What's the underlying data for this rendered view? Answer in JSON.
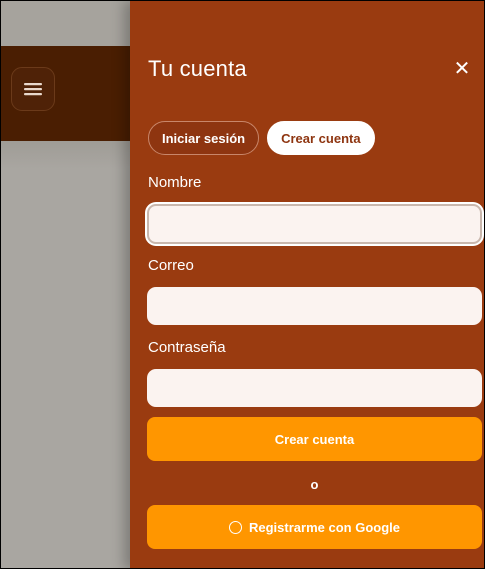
{
  "drawer": {
    "title": "Tu cuenta",
    "close_glyph": "✕",
    "tabs": [
      {
        "label": "Iniciar sesión",
        "active": false
      },
      {
        "label": "Crear cuenta",
        "active": true
      }
    ]
  },
  "form": {
    "name_label": "Nombre",
    "name_value": "",
    "email_label": "Correo",
    "email_value": "",
    "password_label": "Contraseña",
    "password_value": "",
    "submit_label": "Crear cuenta",
    "separator": "o",
    "google_label": "Registrarme con Google",
    "google_icon": "google-circle-icon"
  },
  "background": {
    "menu_icon": "hamburger-menu-icon"
  },
  "colors": {
    "drawer_bg": "#9a3b10",
    "accent": "#ff9600",
    "header_bg": "#4a1e02",
    "input_bg": "#fbf3f0"
  }
}
